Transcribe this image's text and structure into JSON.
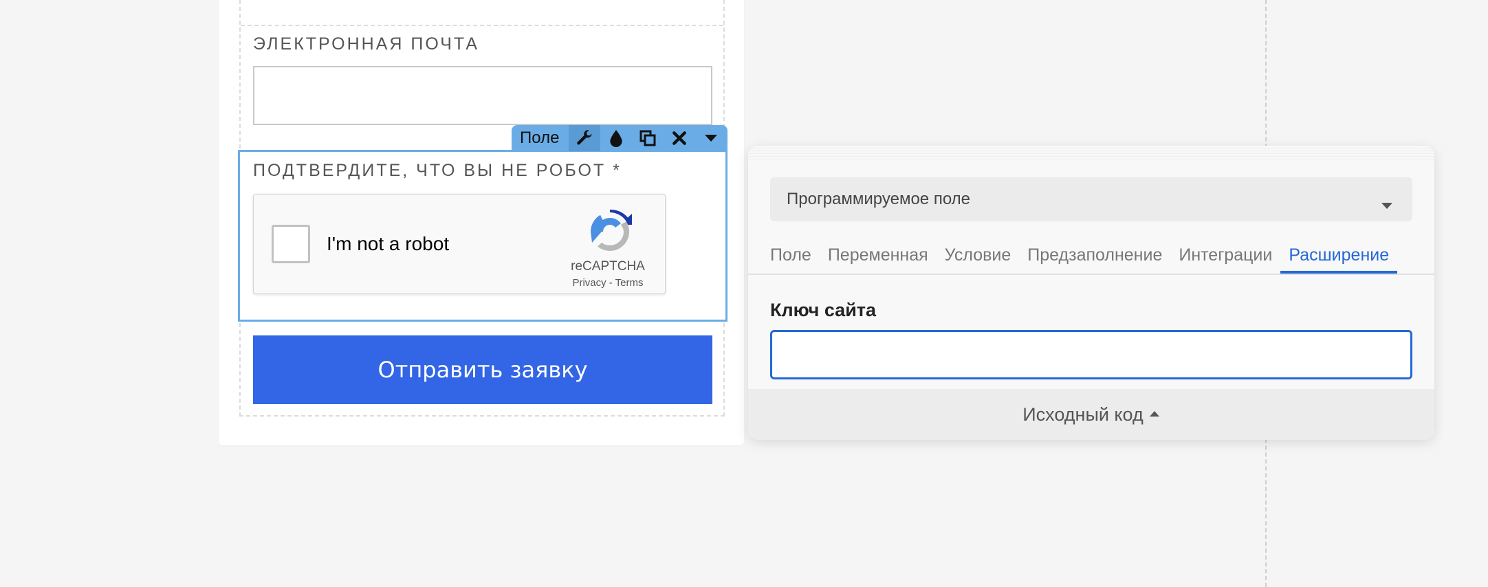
{
  "form": {
    "email_label": "ЭЛЕКТРОННАЯ ПОЧТА",
    "email_value": "",
    "captcha_label": "ПОДТВЕРДИТЕ, ЧТО ВЫ НЕ РОБОТ *",
    "recaptcha": {
      "checkbox_text": "I'm not a robot",
      "brand": "reCAPTCHA",
      "links": "Privacy - Terms"
    },
    "submit_label": "Отправить заявку"
  },
  "field_toolbar": {
    "label": "Поле",
    "icons": [
      "wrench-icon",
      "drop-icon",
      "copy-icon",
      "close-icon",
      "caret-down-icon"
    ],
    "accent": "#6aade6"
  },
  "settings_panel": {
    "field_type": "Программируемое поле",
    "tabs": [
      "Поле",
      "Переменная",
      "Условие",
      "Предзаполнение",
      "Интеграции",
      "Расширение"
    ],
    "active_tab": "Расширение",
    "site_key_label": "Ключ сайта",
    "site_key_value": "",
    "footer_label": "Исходный код",
    "accent": "#2468d6"
  },
  "colors": {
    "submit_button": "#3366e6",
    "selection": "#6aade6"
  }
}
